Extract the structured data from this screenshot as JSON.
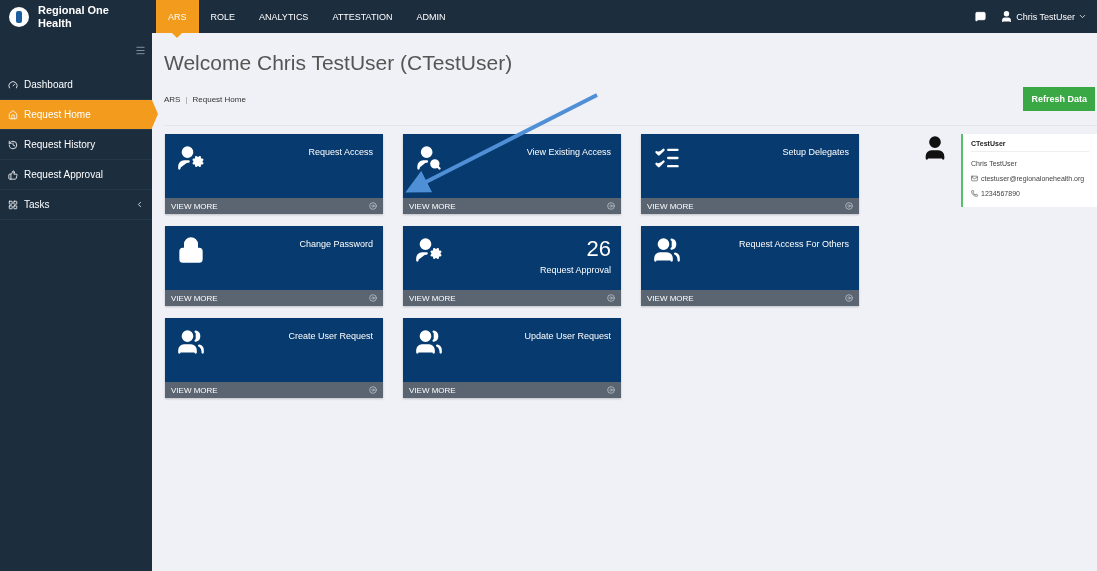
{
  "brand": {
    "name": "Regional One Health"
  },
  "nav": [
    {
      "label": "ARS",
      "selected": true
    },
    {
      "label": "ROLE",
      "selected": false
    },
    {
      "label": "ANALYTICS",
      "selected": false
    },
    {
      "label": "ATTESTATION",
      "selected": false
    },
    {
      "label": "ADMIN",
      "selected": false
    }
  ],
  "user_menu": {
    "name": "Chris TestUser"
  },
  "sidebar": {
    "items": [
      {
        "label": "Dashboard",
        "selected": false
      },
      {
        "label": "Request Home",
        "selected": true
      },
      {
        "label": "Request History",
        "selected": false
      },
      {
        "label": "Request Approval",
        "selected": false
      },
      {
        "label": "Tasks",
        "selected": false
      }
    ]
  },
  "page": {
    "title": "Welcome Chris TestUser (CTestUser)",
    "breadcrumb": [
      "ARS",
      "Request Home"
    ],
    "breadcrumb_separator": "|",
    "refresh_button": "Refresh Data"
  },
  "cards": [
    {
      "title": "Request Access",
      "footer": "VIEW MORE"
    },
    {
      "title": "View Existing Access",
      "footer": "VIEW MORE"
    },
    {
      "title": "Setup Delegates",
      "footer": "VIEW MORE"
    },
    {
      "title": "Change Password",
      "footer": "VIEW MORE"
    },
    {
      "title": "Request Approval",
      "count": "26",
      "footer": "VIEW MORE"
    },
    {
      "title": "Request Access For Others",
      "footer": "VIEW MORE"
    },
    {
      "title": "Create User Request",
      "footer": "VIEW MORE"
    },
    {
      "title": "Update User Request",
      "footer": "VIEW MORE"
    }
  ],
  "profile": {
    "username": "CTestUser",
    "full_name": "Chris TestUser",
    "email": "ctestuser@regionalonehealth.org",
    "phone": "1234567890"
  }
}
